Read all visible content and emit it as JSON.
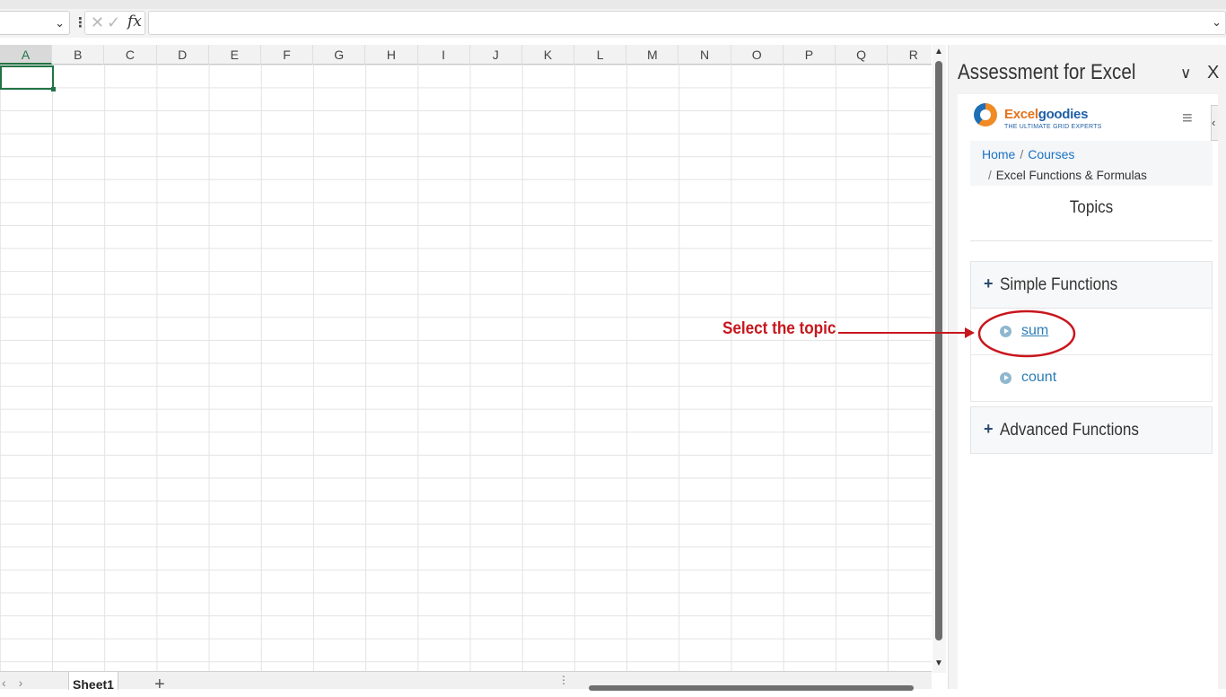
{
  "formula_bar": {
    "namebox_value": "",
    "cancel_glyph": "✕",
    "confirm_glyph": "✓",
    "fx_label": "fx",
    "formula_value": ""
  },
  "grid": {
    "columns": [
      "A",
      "B",
      "C",
      "D",
      "E",
      "F",
      "G",
      "H",
      "I",
      "J",
      "K",
      "L",
      "M",
      "N",
      "O",
      "P",
      "Q",
      "R"
    ],
    "active_column": "A",
    "active_cell": "A1"
  },
  "sheets": {
    "tabs": [
      "Sheet1"
    ],
    "add_label": "+"
  },
  "task_pane": {
    "title": "Assessment for Excel",
    "collapse_glyph": "∨",
    "close_glyph": "X",
    "addin": {
      "logo": {
        "brand_orange": "Excel",
        "brand_blue": "goodies",
        "tagline": "THE ULTIMATE GRID EXPERTS"
      },
      "menu_glyph": "≡",
      "side_glyph": "‹",
      "breadcrumb": {
        "home": "Home",
        "sep": "/",
        "courses": "Courses",
        "current": "Excel Functions & Formulas"
      },
      "topics_heading": "Topics",
      "sections": [
        {
          "label": "Simple Functions",
          "items": [
            "sum",
            "count"
          ]
        },
        {
          "label": "Advanced Functions",
          "items": []
        }
      ]
    }
  },
  "annotation": {
    "text": "Select the topic",
    "color": "#c8161d"
  },
  "colors": {
    "excel_green": "#217346",
    "link_blue": "#2b7db8",
    "annotation_red": "#c8161d"
  }
}
